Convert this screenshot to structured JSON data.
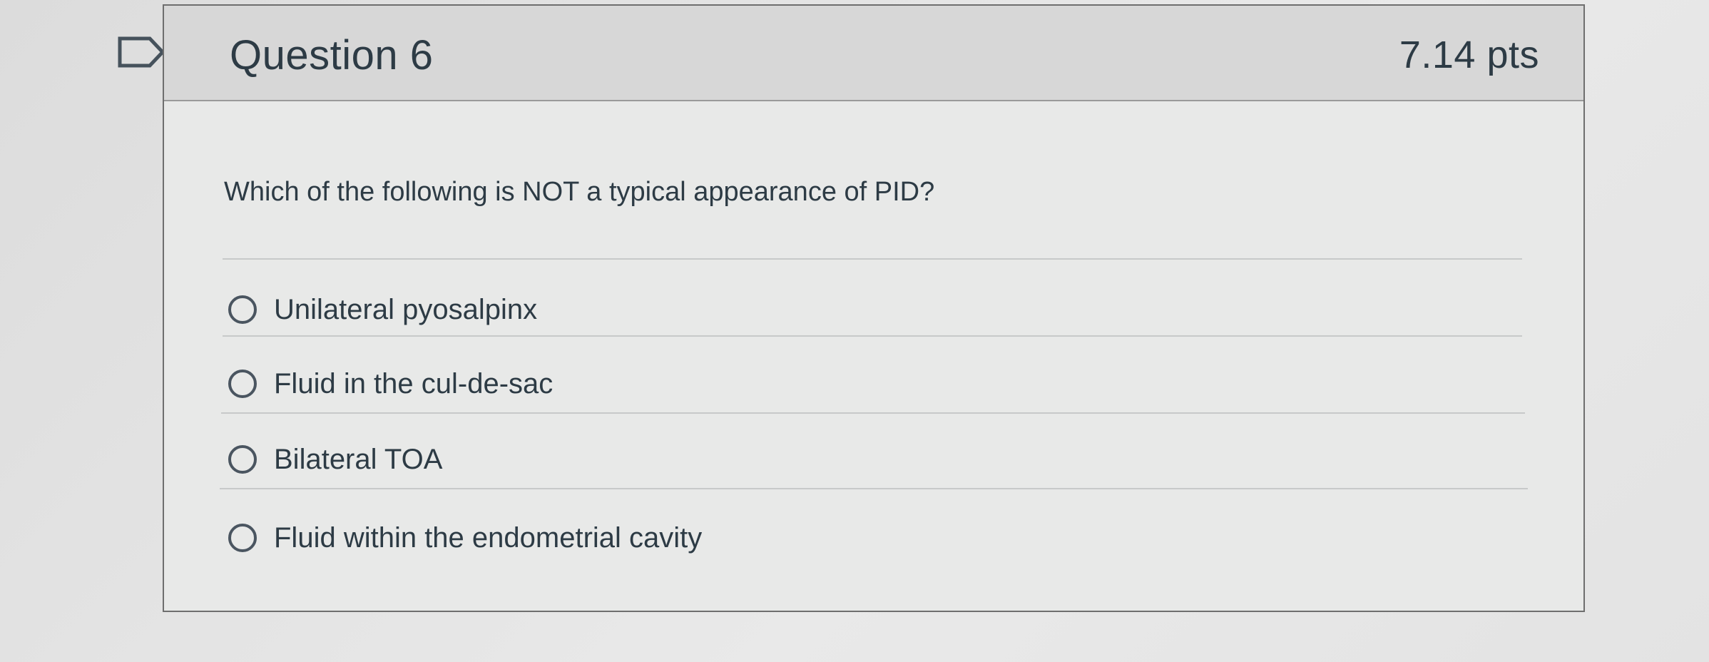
{
  "question": {
    "title": "Question 6",
    "points": "7.14 pts",
    "flag_icon": "flag-outline-icon",
    "text": "Which of the following is NOT a typical appearance of PID?",
    "answers": [
      {
        "label": "Unilateral pyosalpinx",
        "selected": false
      },
      {
        "label": "Fluid in the cul-de-sac",
        "selected": false
      },
      {
        "label": "Bilateral TOA",
        "selected": false
      },
      {
        "label": "Fluid within the endometrial cavity",
        "selected": false
      }
    ]
  },
  "colors": {
    "text": "#2d3b45",
    "header_bg": "#d7d7d7",
    "card_bg": "#e8e9e8",
    "border": "#6e6e6e"
  }
}
